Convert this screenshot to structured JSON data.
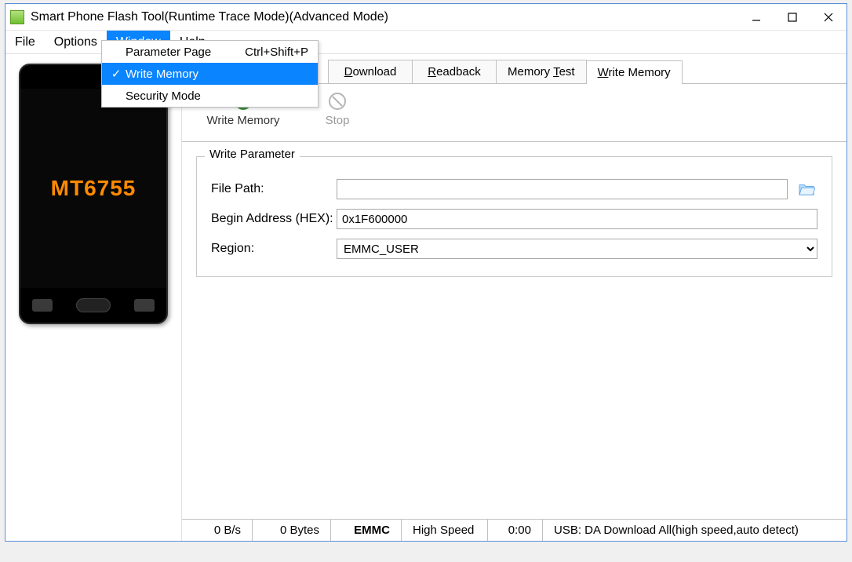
{
  "title": "Smart Phone Flash Tool(Runtime Trace Mode)(Advanced Mode)",
  "menubar": [
    "File",
    "Options",
    "Window",
    "Help"
  ],
  "menubar_active_index": 2,
  "dropdown": {
    "items": [
      {
        "label": "Parameter Page",
        "shortcut": "Ctrl+Shift+P",
        "checked": false,
        "highlight": false
      },
      {
        "label": "Write Memory",
        "shortcut": "",
        "checked": true,
        "highlight": true
      },
      {
        "label": "Security Mode",
        "shortcut": "",
        "checked": false,
        "highlight": false
      }
    ]
  },
  "phone_label": "MT6755",
  "tabs": [
    {
      "label": "Download",
      "underline": "D"
    },
    {
      "label": "Readback",
      "underline": "R"
    },
    {
      "label": "Memory Test",
      "underline": "T"
    },
    {
      "label": "Write Memory",
      "underline": "W"
    }
  ],
  "active_tab_index": 3,
  "toolbar": {
    "write_label": "Write Memory",
    "stop_label": "Stop"
  },
  "form": {
    "legend": "Write Parameter",
    "file_path_label": "File Path:",
    "file_path_value": "",
    "begin_addr_label": "Begin Address (HEX):",
    "begin_addr_value": "0x1F600000",
    "region_label": "Region:",
    "region_value": "EMMC_USER"
  },
  "status": {
    "speed": "0 B/s",
    "size": "0 Bytes",
    "storage": "EMMC",
    "mode": "High Speed",
    "time": "0:00",
    "conn": "USB: DA Download All(high speed,auto detect)"
  }
}
